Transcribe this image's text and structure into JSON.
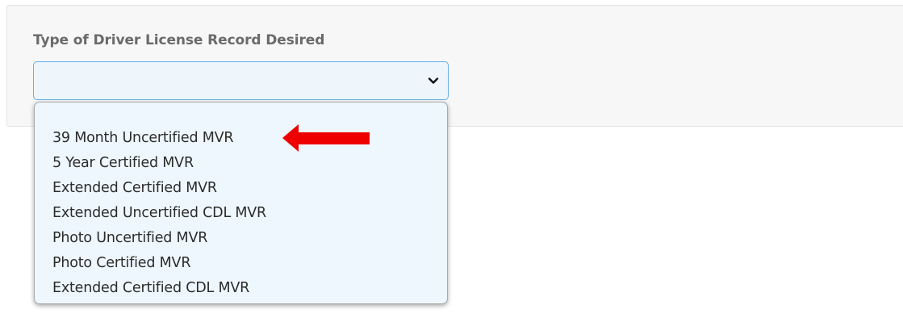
{
  "form": {
    "field_label": "Type of Driver License Record Desired",
    "selected_value": "",
    "options": [
      {
        "label": "39 Month Uncertified MVR"
      },
      {
        "label": "5 Year Certified MVR"
      },
      {
        "label": "Extended Certified MVR"
      },
      {
        "label": "Extended Uncertified CDL MVR"
      },
      {
        "label": "Photo Uncertified MVR"
      },
      {
        "label": "Photo Certified MVR"
      },
      {
        "label": "Extended Certified CDL MVR"
      }
    ]
  },
  "annotation": {
    "icon": "red-arrow-left-icon",
    "color": "#ee0000",
    "points_to_option_index": 0
  },
  "colors": {
    "panel_background": "#f7f7f7",
    "select_border": "#66afe9",
    "dropdown_background": "#eef7fd",
    "label_text": "#6a6a6a"
  }
}
